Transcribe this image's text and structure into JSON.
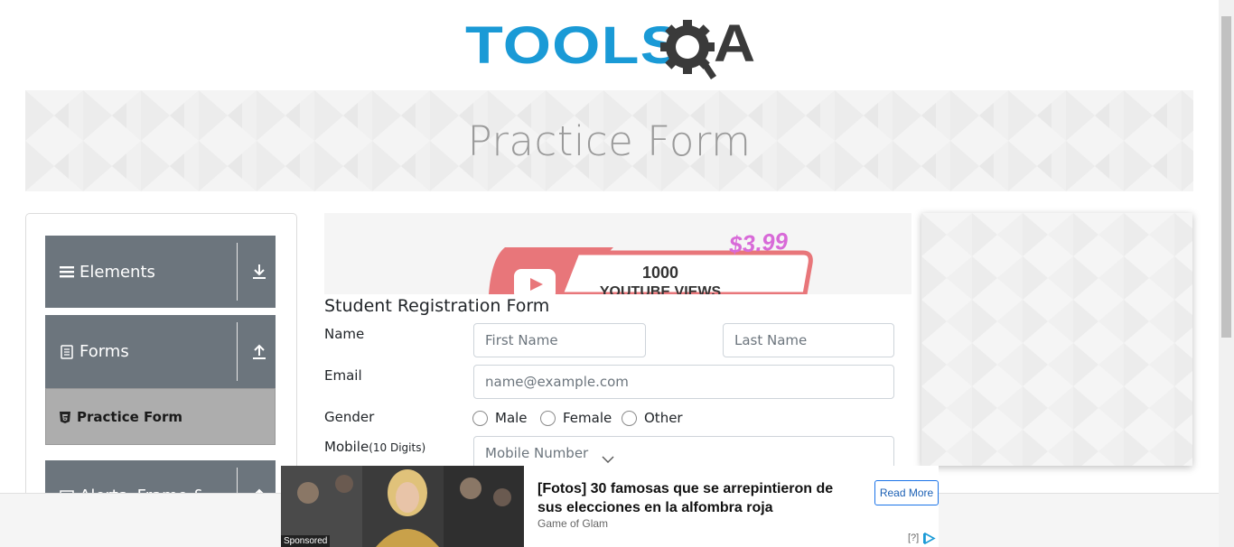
{
  "header": {
    "logo_text_tools": "TOOLS",
    "logo_text_a": "A"
  },
  "banner": {
    "title": "Practice Form"
  },
  "sidebar": {
    "groups": [
      {
        "label": "Elements",
        "icon": "menu-icon",
        "arrow": "download-arrow-icon"
      },
      {
        "label": "Forms",
        "icon": "document-icon",
        "arrow": "upload-arrow-icon"
      },
      {
        "label": "Alerts, Frame &",
        "icon": "window-icon",
        "arrow": "upload-arrow-icon"
      }
    ],
    "active_item": "Practice Form"
  },
  "ad_top": {
    "price": "$3.99",
    "line1": "1000",
    "line2": "YOUTUBE VIEWS"
  },
  "form": {
    "title": "Student Registration Form",
    "name_label": "Name",
    "first_name_placeholder": "First Name",
    "last_name_placeholder": "Last Name",
    "email_label": "Email",
    "email_placeholder": "name@example.com",
    "gender_label": "Gender",
    "gender_options": [
      "Male",
      "Female",
      "Other"
    ],
    "mobile_label": "Mobile",
    "mobile_hint": "(10 Digits)",
    "mobile_placeholder": "Mobile Number"
  },
  "bottom_ad": {
    "sponsored": "Sponsored",
    "headline": "[Fotos] 30 famosas que se arrepintieron de sus elecciones en la alfombra roja",
    "source": "Game of Glam",
    "button": "Read More",
    "info": "[?]"
  },
  "colors": {
    "brand_blue": "#1a9ad6",
    "sidebar_bg": "#6c757d",
    "active_item_bg": "#adadad"
  }
}
